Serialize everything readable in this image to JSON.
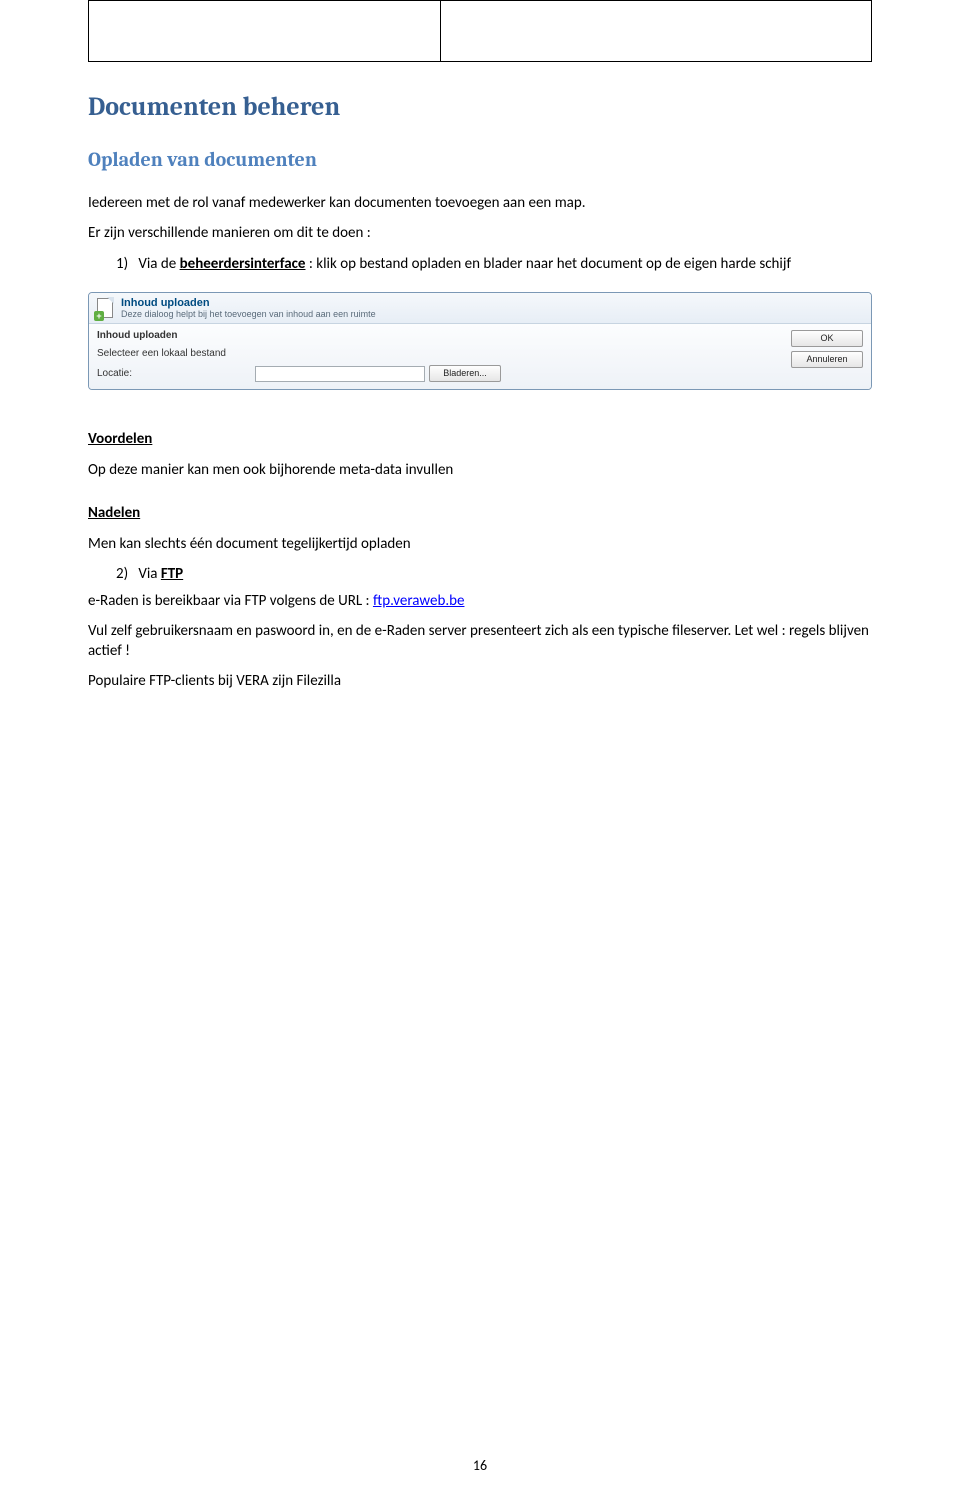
{
  "heading1": "Documenten beheren",
  "heading2": "Opladen van documenten",
  "intro1": "Iedereen met de rol vanaf  medewerker kan documenten toevoegen aan een map.",
  "intro2": "Er zijn verschillende manieren om dit te doen :",
  "item1": {
    "num": "1)",
    "pre": "Via de ",
    "bold": "beheerdersinterface",
    "post": " : klik op bestand opladen en blader naar het document op de eigen harde schijf"
  },
  "dialog": {
    "title": "Inhoud uploaden",
    "subtitle": "Deze dialoog helpt bij het toevoegen van inhoud aan een ruimte",
    "section": "Inhoud uploaden",
    "selectLabel": "Selecteer een lokaal bestand",
    "locLabel": "Locatie:",
    "browse": "Bladeren...",
    "ok": "OK",
    "cancel": "Annuleren"
  },
  "voordelen": {
    "title": "Voordelen",
    "text": "Op deze manier kan men ook bijhorende meta-data invullen"
  },
  "nadelen": {
    "title": "Nadelen",
    "text": "Men kan slechts één document tegelijkertijd opladen"
  },
  "item2": {
    "num": "2)",
    "pre": "Via ",
    "bold": "FTP"
  },
  "ftp": {
    "line1_pre": "e-Raden is bereikbaar via FTP volgens de URL : ",
    "link": "ftp.veraweb.be",
    "line2": "Vul zelf gebruikersnaam en paswoord in, en de e-Raden server presenteert zich als een typische fileserver. Let wel : regels blijven actief !",
    "line3": "Populaire FTP-clients bij VERA zijn Filezilla"
  },
  "pageNumber": "16"
}
